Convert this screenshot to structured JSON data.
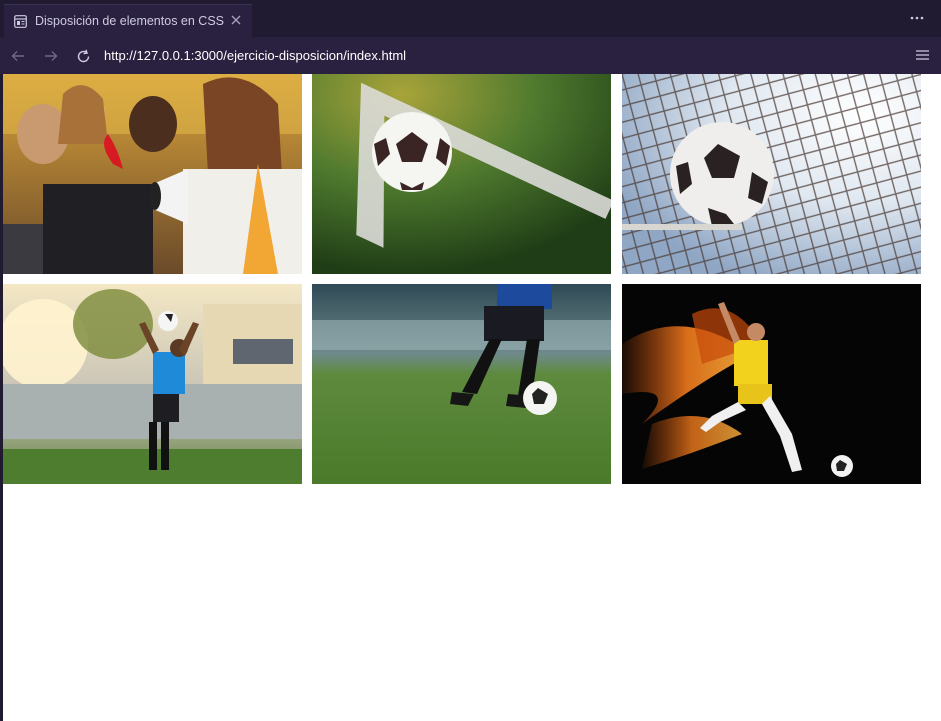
{
  "browser": {
    "tab_title": "Disposición de elementos en CSS",
    "url": "http://127.0.0.1:3000/ejercicio-disposicion/index.html",
    "icons": {
      "favicon": "page-icon",
      "close": "close-icon",
      "more": "ellipsis-icon",
      "back": "arrow-left-icon",
      "forward": "arrow-right-icon",
      "reload": "reload-icon",
      "menu": "hamburger-icon"
    }
  },
  "gallery": {
    "images": [
      {
        "subject": "cheering football fans with megaphone"
      },
      {
        "subject": "soccer ball at corner line on grass"
      },
      {
        "subject": "soccer ball hitting the goal net"
      },
      {
        "subject": "player heading ball in stadium"
      },
      {
        "subject": "player legs with ball on pitch"
      },
      {
        "subject": "player in yellow kicking ball with fire motion"
      }
    ]
  }
}
